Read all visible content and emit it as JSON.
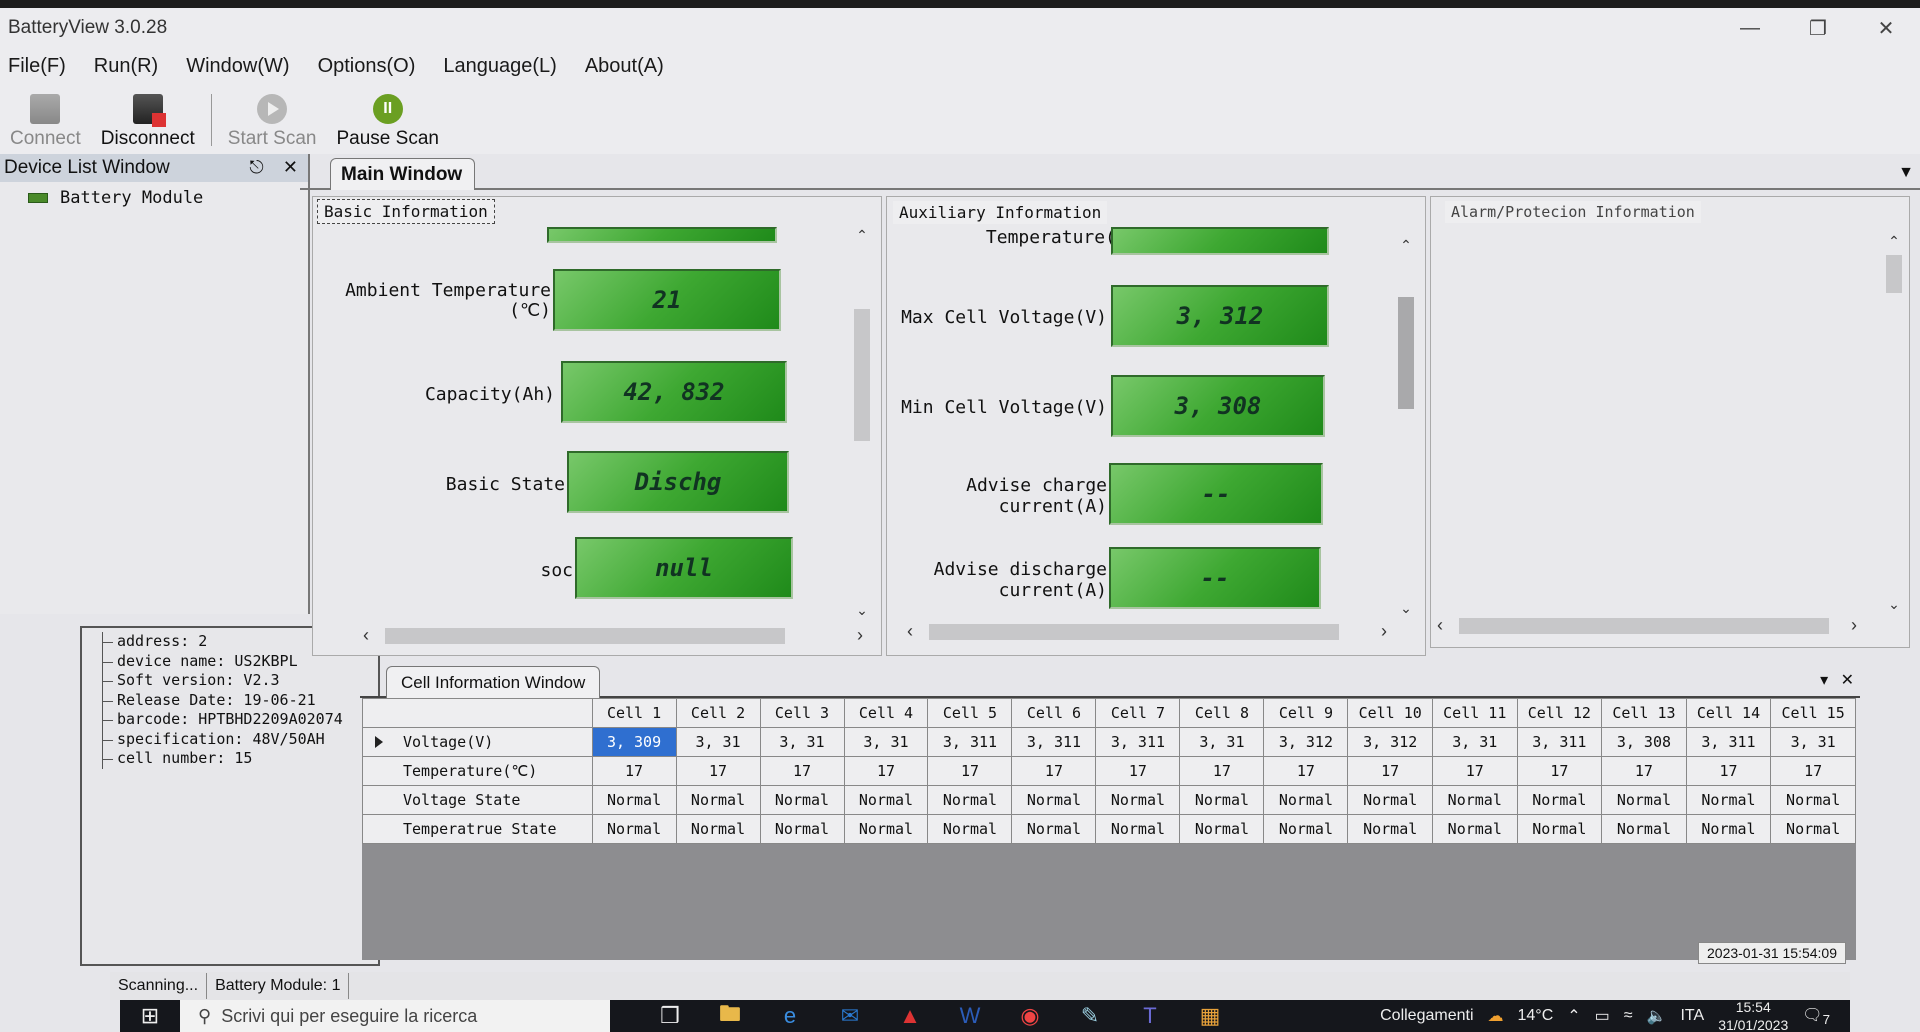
{
  "window": {
    "title": "BatteryView 3.0.28",
    "controls": [
      "minimize",
      "restore",
      "close"
    ]
  },
  "menu": [
    "File(F)",
    "Run(R)",
    "Window(W)",
    "Options(O)",
    "Language(L)",
    "About(A)"
  ],
  "toolbar": {
    "connect": "Connect",
    "disconnect": "Disconnect",
    "start_scan": "Start Scan",
    "pause_scan": "Pause Scan"
  },
  "device_list": {
    "title": "Device List Window",
    "tree_item": "Battery Module",
    "info": [
      "address: 2",
      "device name: US2KBPL",
      "Soft  version: V2.3",
      "Release Date: 19-06-21",
      "barcode: HPTBHD2209A02074",
      "specification: 48V/50AH",
      "cell number: 15"
    ]
  },
  "main": {
    "tab": "Main Window",
    "basic": {
      "title": "Basic Information",
      "fields": [
        {
          "label": "Ambient Temperature\n(℃)",
          "value": "21"
        },
        {
          "label": "Capacity(Ah)",
          "value": "42, 832"
        },
        {
          "label": "Basic State",
          "value": "Dischg"
        },
        {
          "label": "soc",
          "value": "null"
        }
      ]
    },
    "auxiliary": {
      "title": "Auxiliary Information",
      "partial_label": "Temperature(℃)",
      "fields": [
        {
          "label": "Max Cell Voltage(V)",
          "value": "3, 312"
        },
        {
          "label": "Min Cell Voltage(V)",
          "value": "3, 308"
        },
        {
          "label": "Advise charge\ncurrent(A)",
          "value": "--"
        },
        {
          "label": "Advise discharge\ncurrent(A)",
          "value": "--"
        }
      ]
    },
    "alarm": {
      "title": "Alarm/Protecion Information"
    }
  },
  "cell_window": {
    "tab": "Cell Information Window",
    "columns": [
      "Cell 1",
      "Cell 2",
      "Cell 3",
      "Cell 4",
      "Cell 5",
      "Cell 6",
      "Cell 7",
      "Cell 8",
      "Cell 9",
      "Cell 10",
      "Cell 11",
      "Cell 12",
      "Cell 13",
      "Cell 14",
      "Cell 15"
    ],
    "rows": [
      {
        "label": "Voltage(V)",
        "values": [
          "3, 309",
          "3, 31",
          "3, 31",
          "3, 31",
          "3, 311",
          "3, 311",
          "3, 311",
          "3, 31",
          "3, 312",
          "3, 312",
          "3, 31",
          "3, 311",
          "3, 308",
          "3, 311",
          "3, 31"
        ]
      },
      {
        "label": "Temperature(℃)",
        "values": [
          "17",
          "17",
          "17",
          "17",
          "17",
          "17",
          "17",
          "17",
          "17",
          "17",
          "17",
          "17",
          "17",
          "17",
          "17"
        ]
      },
      {
        "label": "Voltage State",
        "values": [
          "Normal",
          "Normal",
          "Normal",
          "Normal",
          "Normal",
          "Normal",
          "Normal",
          "Normal",
          "Normal",
          "Normal",
          "Normal",
          "Normal",
          "Normal",
          "Normal",
          "Normal"
        ]
      },
      {
        "label": "Temperatrue State",
        "values": [
          "Normal",
          "Normal",
          "Normal",
          "Normal",
          "Normal",
          "Normal",
          "Normal",
          "Normal",
          "Normal",
          "Normal",
          "Normal",
          "Normal",
          "Normal",
          "Normal",
          "Normal"
        ]
      }
    ]
  },
  "status": {
    "scanning": "Scanning...",
    "module": "Battery Module: 1",
    "datetime": "2023-01-31 15:54:09"
  },
  "taskbar": {
    "search_placeholder": "Scrivi qui per eseguire la ricerca",
    "links": "Collegamenti",
    "weather": "14°C",
    "lang": "ITA",
    "time": "15:54",
    "date": "31/01/2023",
    "notifications": "7"
  }
}
